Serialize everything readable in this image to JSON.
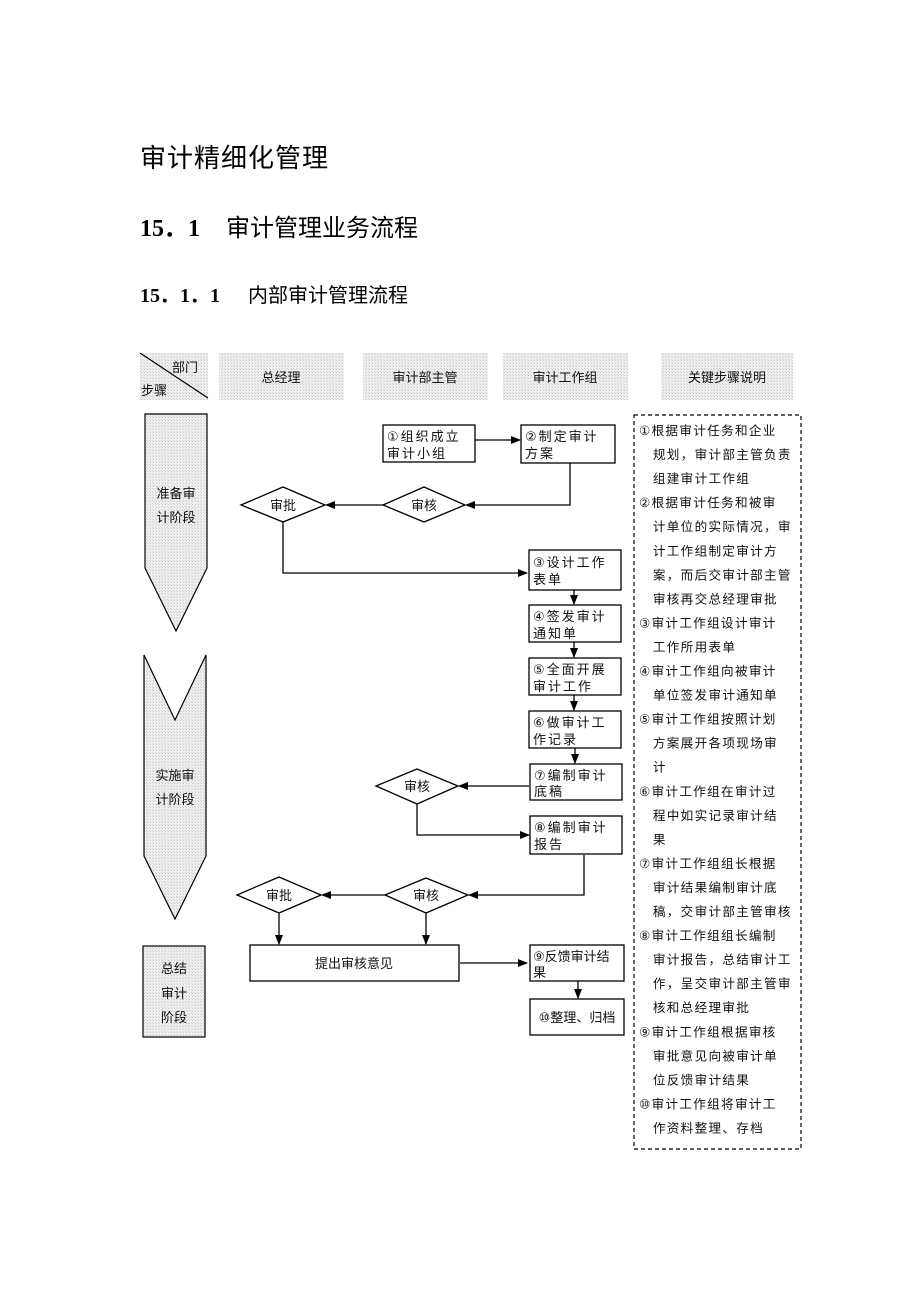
{
  "document": {
    "title": "审计精细化管理",
    "section": {
      "number": "15．1",
      "title": "审计管理业务流程"
    },
    "subsection": {
      "number": "15．1．1",
      "title": "内部审计管理流程"
    }
  },
  "diagram": {
    "corner": {
      "top_label": "部门",
      "bottom_label": "步骤"
    },
    "columns": [
      {
        "id": "gm",
        "label": "总经理"
      },
      {
        "id": "head",
        "label": "审计部主管"
      },
      {
        "id": "team",
        "label": "审计工作组"
      },
      {
        "id": "notes",
        "label": "关键步骤说明"
      }
    ],
    "phases": [
      {
        "id": "prepare",
        "lines": [
          "准备审",
          "计阶段"
        ]
      },
      {
        "id": "implement",
        "lines": [
          "实施审",
          "计阶段"
        ]
      },
      {
        "id": "summary",
        "lines": [
          "总结",
          "审计",
          "阶段"
        ]
      }
    ],
    "steps": [
      {
        "id": "s1",
        "lines": [
          "①组织成立",
          "审计小组"
        ]
      },
      {
        "id": "s2",
        "lines": [
          "②制定审计",
          "方案"
        ]
      },
      {
        "id": "s3",
        "lines": [
          "③设计工作",
          "表单"
        ]
      },
      {
        "id": "s4",
        "lines": [
          "④签发审计",
          "通知单"
        ]
      },
      {
        "id": "s5",
        "lines": [
          "⑤全面开展",
          "审计工作"
        ]
      },
      {
        "id": "s6",
        "lines": [
          "⑥做审计工",
          "作记录"
        ]
      },
      {
        "id": "s7",
        "lines": [
          "⑦编制审计",
          "底稿"
        ]
      },
      {
        "id": "s8",
        "lines": [
          "⑧编制审计",
          "报告"
        ]
      },
      {
        "id": "s9",
        "lines": [
          "⑨反馈审计结",
          "果"
        ]
      },
      {
        "id": "s10",
        "lines": [
          "⑩整理、归档"
        ]
      },
      {
        "id": "opinion",
        "lines": [
          "提出审核意见"
        ]
      }
    ],
    "decisions": [
      {
        "id": "d1_approve",
        "label": "审批"
      },
      {
        "id": "d1_review",
        "label": "审核"
      },
      {
        "id": "d2_review",
        "label": "审核"
      },
      {
        "id": "d3_approve",
        "label": "审批"
      },
      {
        "id": "d3_review",
        "label": "审核"
      }
    ],
    "notes": [
      "①根据审计任务和企业",
      "　规划，审计部主管负责",
      "　组建审计工作组",
      "②根据审计任务和被审",
      "　计单位的实际情况，审",
      "　计工作组制定审计方",
      "　案，而后交审计部主管",
      "　审核再交总经理审批",
      "③审计工作组设计审计",
      "　工作所用表单",
      "④审计工作组向被审计",
      "　单位签发审计通知单",
      "⑤审计工作组按照计划",
      "　方案展开各项现场审",
      "　计",
      "⑥审计工作组在审计过",
      "　程中如实记录审计结",
      "　果",
      "⑦审计工作组组长根据",
      "　审计结果编制审计底",
      "　稿，交审计部主管审核",
      "⑧审计工作组组长编制",
      "　审计报告，总结审计工",
      "　作，呈交审计部主管审",
      "　核和总经理审批",
      "⑨审计工作组根据审核",
      "　审批意见向被审计单",
      "　位反馈审计结果",
      "⑩审计工作组将审计工",
      "　作资料整理、存档"
    ]
  }
}
